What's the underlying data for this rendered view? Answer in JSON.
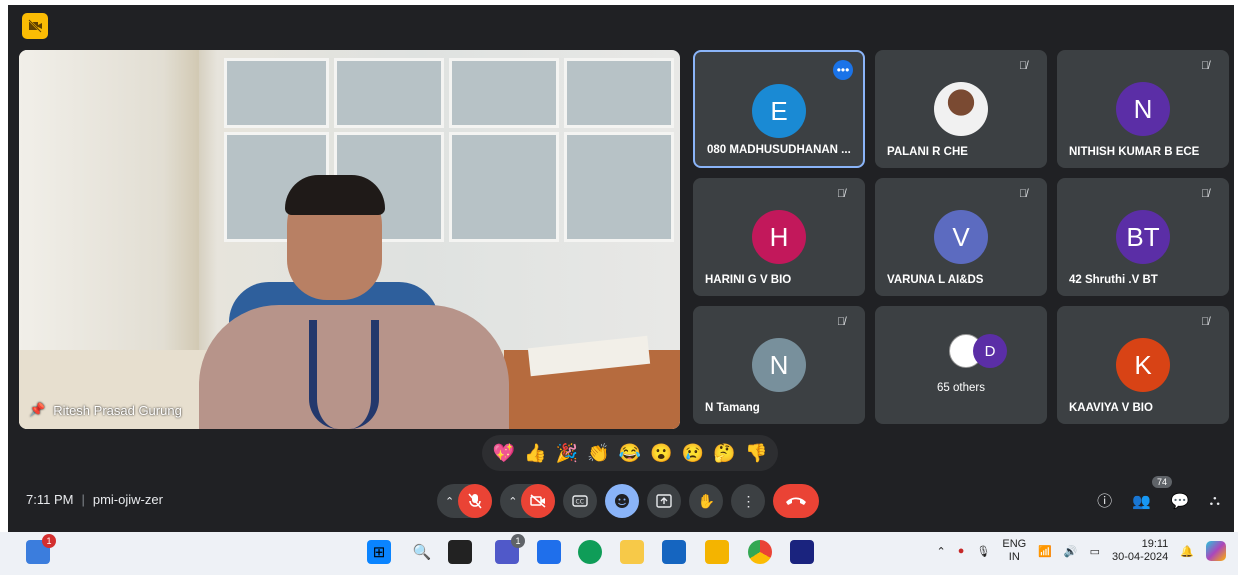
{
  "speaker": {
    "name": "Ritesh Prasad Gurung"
  },
  "tiles": [
    {
      "initial": "E",
      "name": "080 MADHUSUDHANAN ...",
      "color": "#1a8ad4",
      "active": true
    },
    {
      "initial": "",
      "name": "PALANI R CHE",
      "color": "#6b4a3a",
      "photo": true
    },
    {
      "initial": "N",
      "name": "NITHISH KUMAR B ECE",
      "color": "#5b2ea6"
    },
    {
      "initial": "H",
      "name": "HARINI G V BIO",
      "color": "#c2185b"
    },
    {
      "initial": "V",
      "name": "VARUNA L AI&DS",
      "color": "#5c6bc0"
    },
    {
      "initial": "BT",
      "name": "42 Shruthi .V BT",
      "color": "#5b2ea6"
    },
    {
      "initial": "N",
      "name": "N Tamang",
      "color": "#78909c"
    },
    {
      "initial": "D",
      "name": "65 others",
      "color": "#5b2ea6",
      "others": true
    },
    {
      "initial": "K",
      "name": "KAAVIYA V BIO",
      "color": "#d84315"
    }
  ],
  "reactions": [
    "💖",
    "👍",
    "🎉",
    "👏",
    "😂",
    "😮",
    "😢",
    "🤔",
    "👎"
  ],
  "meeting": {
    "time": "7:11 PM",
    "separator": "|",
    "code": "pmi-ojiw-zer"
  },
  "participants_count": "74",
  "taskbar": {
    "lang_top": "ENG",
    "lang_bottom": "IN",
    "clock_time": "19:11",
    "clock_date": "30-04-2024",
    "notif_badge": "1",
    "chat_badge": "1"
  },
  "icons": {
    "mic": "mic-off-icon",
    "cam": "camera-off-icon",
    "captions": "captions-icon",
    "effects": "emoji-icon",
    "present": "present-icon",
    "raise_hand": "hand-icon",
    "more": "more-icon",
    "hangup": "hangup-icon"
  }
}
